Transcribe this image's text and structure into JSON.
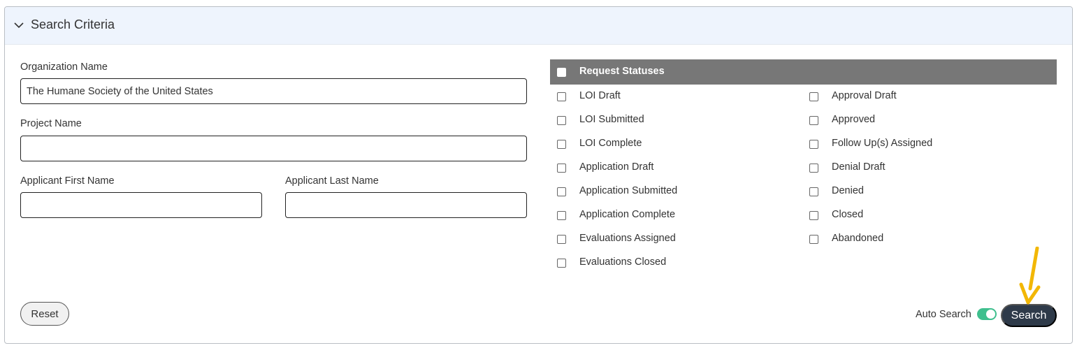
{
  "panel": {
    "title": "Search Criteria",
    "toggle_icon": "chevron-down-icon"
  },
  "form": {
    "organization_name": {
      "label": "Organization Name",
      "value": "The Humane Society of the United States"
    },
    "project_name": {
      "label": "Project Name",
      "value": ""
    },
    "applicant_first_name": {
      "label": "Applicant First Name",
      "value": ""
    },
    "applicant_last_name": {
      "label": "Applicant Last Name",
      "value": ""
    }
  },
  "statuses": {
    "header": "Request Statuses",
    "left": [
      {
        "label": "LOI Draft",
        "checked": false
      },
      {
        "label": "LOI Submitted",
        "checked": false
      },
      {
        "label": "LOI Complete",
        "checked": false
      },
      {
        "label": "Application Draft",
        "checked": false
      },
      {
        "label": "Application Submitted",
        "checked": false
      },
      {
        "label": "Application Complete",
        "checked": false
      },
      {
        "label": "Evaluations Assigned",
        "checked": false
      },
      {
        "label": "Evaluations Closed",
        "checked": false
      }
    ],
    "right": [
      {
        "label": "Approval Draft",
        "checked": false
      },
      {
        "label": "Approved",
        "checked": false
      },
      {
        "label": "Follow Up(s) Assigned",
        "checked": false
      },
      {
        "label": "Denial Draft",
        "checked": false
      },
      {
        "label": "Denied",
        "checked": false
      },
      {
        "label": "Closed",
        "checked": false
      },
      {
        "label": "Abandoned",
        "checked": false
      }
    ]
  },
  "actions": {
    "reset_label": "Reset",
    "auto_search_label": "Auto Search",
    "auto_search_on": true,
    "search_label": "Search"
  },
  "colors": {
    "header_bg": "#eef4fd",
    "status_header_bg": "#777777",
    "toggle_on": "#3fbf8e",
    "search_button": "#2e3a49",
    "annotation_arrow": "#f2b705"
  }
}
